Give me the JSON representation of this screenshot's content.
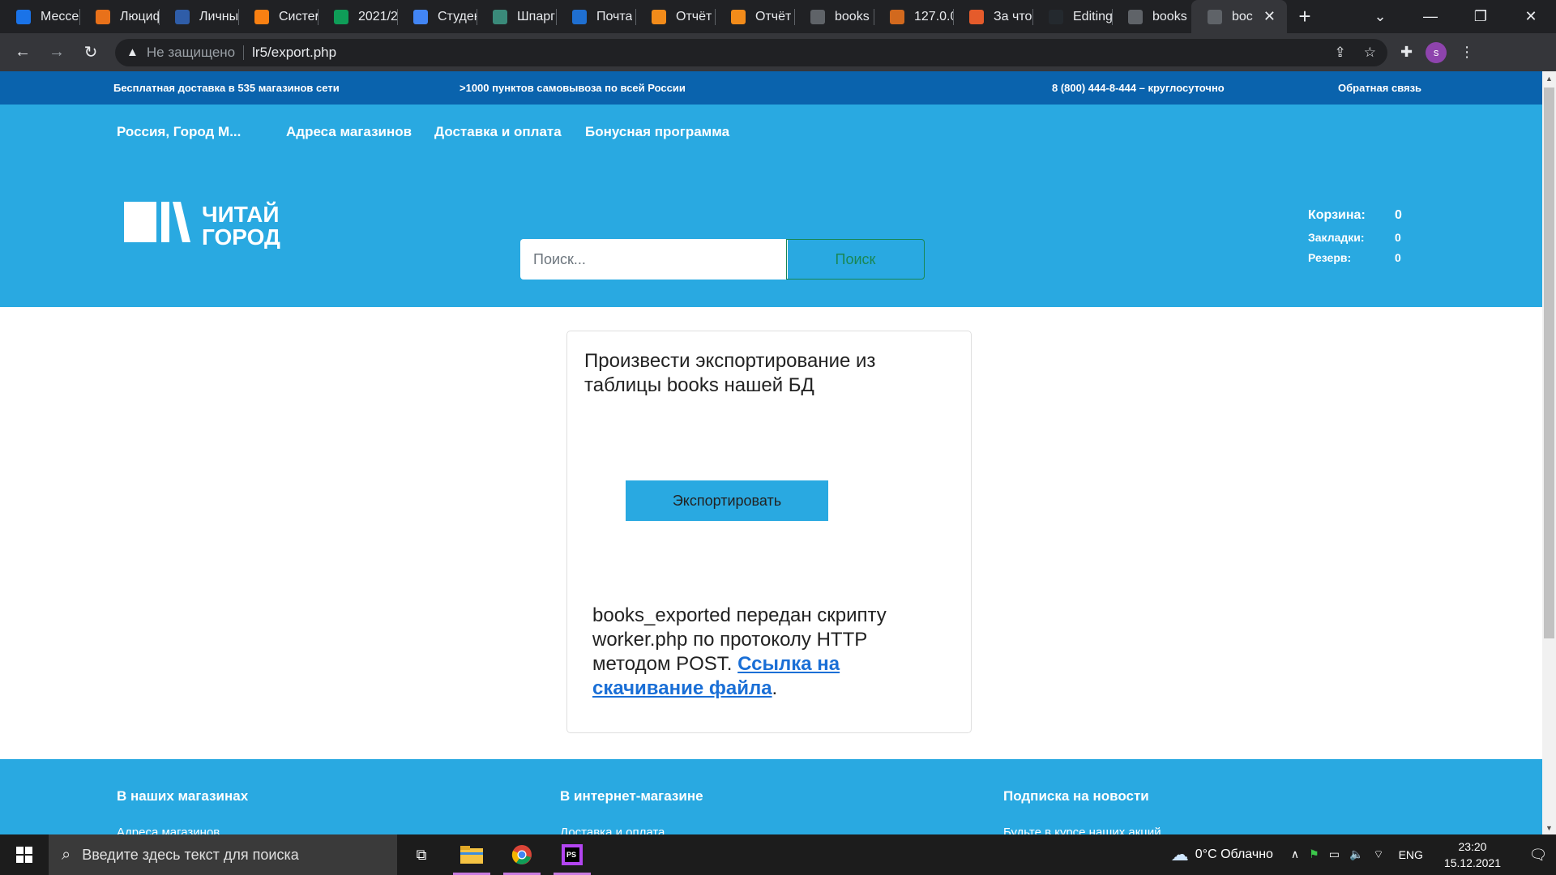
{
  "browser": {
    "tabs": [
      {
        "label": "Мессе",
        "icon": "messenger-icon",
        "color": "#1a73e8"
      },
      {
        "label": "Люциф",
        "icon": "litres-icon",
        "color": "#e8711a"
      },
      {
        "label": "Личны",
        "icon": "yandex-icon",
        "color": "#2f5da8"
      },
      {
        "label": "Систем",
        "icon": "moodle-icon",
        "color": "#f98012"
      },
      {
        "label": "2021/2",
        "icon": "sheets-icon",
        "color": "#0f9d58"
      },
      {
        "label": "Студен",
        "icon": "docs-icon",
        "color": "#4285f4"
      },
      {
        "label": "Шпарг",
        "icon": "cheatsheet-icon",
        "color": "#3a8a7a"
      },
      {
        "label": "Почта",
        "icon": "mail-icon",
        "color": "#1f6fd1"
      },
      {
        "label": "Отчёт",
        "icon": "cloud-icon",
        "color": "#f28b1a"
      },
      {
        "label": "Отчёт",
        "icon": "cloud-icon",
        "color": "#f28b1a"
      },
      {
        "label": "books",
        "icon": "globe-icon",
        "color": "#5f6368"
      },
      {
        "label": "127.0.0",
        "icon": "server-icon",
        "color": "#d2691e"
      },
      {
        "label": "За что",
        "icon": "spiral-icon",
        "color": "#e55b2b"
      },
      {
        "label": "Editing",
        "icon": "github-icon",
        "color": "#24292e"
      },
      {
        "label": "books",
        "icon": "globe-icon",
        "color": "#5f6368"
      },
      {
        "label": "boc",
        "icon": "globe-icon",
        "color": "#5f6368",
        "active": true
      }
    ],
    "url_warning": "Не защищено",
    "url": "lr5/export.php",
    "profile_initial": "s"
  },
  "site": {
    "topbar": {
      "delivery": "Бесплатная доставка в 535 магазинов сети",
      "pickup": ">1000 пунктов самовывоза по всей России",
      "phone": "8 (800) 444-8-444 – круглосуточно",
      "feedback": "Обратная связь"
    },
    "nav": {
      "region": "Россия, Город М...",
      "stores": "Адреса магазинов",
      "delivery": "Доставка и оплата",
      "bonus": "Бонусная программа"
    },
    "logo": {
      "line1": "ЧИТАЙ",
      "line2": "ГОРОД"
    },
    "search": {
      "placeholder": "Поиск...",
      "button": "Поиск"
    },
    "counters": {
      "cart_label": "Корзина:",
      "cart_value": "0",
      "bookmarks_label": "Закладки:",
      "bookmarks_value": "0",
      "reserve_label": "Резерв:",
      "reserve_value": "0"
    },
    "card": {
      "title": "Произвести экспортирование из таблицы books нашей БД",
      "button": "Экспортировать",
      "message": "books_exported передан скрипту worker.php по протоколу HTTP методом POST.",
      "link": "Ссылка на скачивание файла",
      "period": "."
    },
    "footer": {
      "col1_title": "В наших магазинах",
      "col1_link": "Адреса магазинов",
      "col2_title": "В интернет-магазине",
      "col2_link": "Доставка и оплата",
      "col3_title": "Подписка на новости",
      "col3_link": "Будьте в курсе наших акций"
    }
  },
  "taskbar": {
    "search_placeholder": "Введите здесь текст для поиска",
    "weather": "0°C  Облачно",
    "lang": "ENG",
    "time": "23:20",
    "date": "15.12.2021"
  },
  "colors": {
    "header_blue": "#29a9e1",
    "topbar_blue": "#0a63ad",
    "search_green": "#198754",
    "link_blue": "#1a6fd6"
  }
}
